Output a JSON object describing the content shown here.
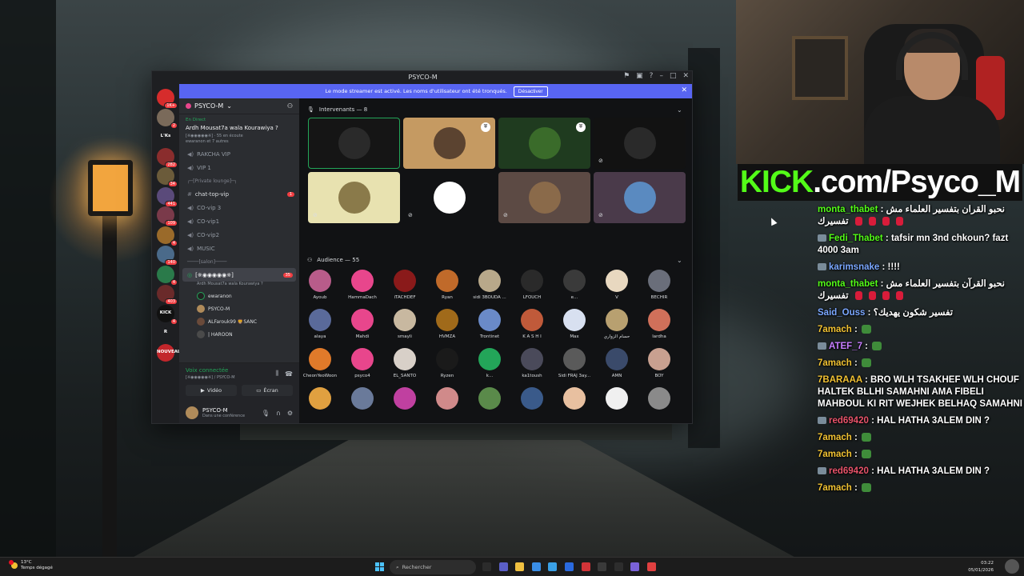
{
  "discord": {
    "window_title": "PSYCO-M",
    "banner": {
      "text": "Le mode streamer est activé. Les noms d'utilisateur ont été tronqués.",
      "button": "Désactiver"
    },
    "guilds": [
      {
        "label": "",
        "badge": "1K+",
        "color": "#d62c2c"
      },
      {
        "label": "",
        "badge": "2",
        "color": "#7a6a5a"
      },
      {
        "label": "L'Ks",
        "badge": "",
        "color": "#1e1f22"
      },
      {
        "label": "",
        "badge": "282",
        "color": "#8a2d2d"
      },
      {
        "label": "",
        "badge": "34",
        "color": "#6b5b3a"
      },
      {
        "label": "",
        "badge": "441",
        "color": "#5a4a7a"
      },
      {
        "label": "",
        "badge": "109",
        "color": "#7a3a4a"
      },
      {
        "label": "",
        "badge": "4",
        "color": "#9a6a2a"
      },
      {
        "label": "",
        "badge": "140",
        "color": "#4a6a8a"
      },
      {
        "label": "",
        "badge": "4",
        "color": "#2a7a4a"
      },
      {
        "label": "",
        "badge": "403",
        "color": "#6a2a2a"
      },
      {
        "label": "KICK",
        "badge": "4",
        "color": "#111"
      },
      {
        "label": "R",
        "badge": "",
        "color": "#1e1f22"
      },
      {
        "label": "NOUVEAU",
        "badge": "",
        "color": "#c2262b"
      }
    ],
    "server_name": "PSYCO-M",
    "live": {
      "label": "En Direct",
      "event_title": "Ardh Mousat7a wala Kourawiya ?",
      "meta": "[※◉◉◉◉◉※] · 55 en écoute",
      "hosts": "ewaranon et 7 autres"
    },
    "channels": [
      {
        "type": "voice",
        "name": "RAKCHA VIP"
      },
      {
        "type": "voice",
        "name": "VIP 1"
      }
    ],
    "category_private": "┌─[Private lounge]─┐",
    "private_channels": [
      {
        "type": "text",
        "name": "chat-top-vip",
        "badge": "1"
      },
      {
        "type": "voice",
        "name": "CO-vip 3"
      },
      {
        "type": "voice",
        "name": "CO-vip1"
      },
      {
        "type": "voice",
        "name": "CO-vip2"
      },
      {
        "type": "voice",
        "name": "MUSIC"
      }
    ],
    "category_salon": "────[salon]────",
    "stage_channel": {
      "name": "[※◉◉◉◉◉※]",
      "badge": "35",
      "sub": "Ardh Mousat7a wala Kourawiya ?"
    },
    "stage_members": [
      "ewaranon",
      "PSYCO-M",
      "ALFarouk99 🦁SANC",
      "| HAROON"
    ],
    "voice_panel": {
      "status": "Voix connectée",
      "location": "[※◉◉◉◉◉※] / PSYCO-M",
      "video": "Vidéo",
      "screen": "Écran"
    },
    "user": {
      "name": "PSYCO-M",
      "status": "Dans une conférence"
    },
    "speakers_header": "Intervenants — 8",
    "audience_header": "Audience — 55",
    "speakers": [
      {
        "color": "#151515",
        "av": "#2a2a2a",
        "shield": false,
        "mic_off": false,
        "active": true
      },
      {
        "color": "#c59a62",
        "av": "#5b4330",
        "shield": true,
        "mic_off": false,
        "active": false
      },
      {
        "color": "#1f3b1f",
        "av": "#3a6b2a",
        "shield": true,
        "mic_off": false,
        "active": false
      },
      {
        "color": "#121212",
        "av": "#2a2a2a",
        "shield": false,
        "mic_off": true,
        "active": false
      },
      {
        "color": "#e8e2b0",
        "av": "#8a7a4a",
        "shield": false,
        "mic_off": true,
        "active": false
      },
      {
        "color": "#111214",
        "av": "#ffffff",
        "shield": false,
        "mic_off": true,
        "active": false
      },
      {
        "color": "#5c4a44",
        "av": "#8a6a4a",
        "shield": false,
        "mic_off": true,
        "active": false
      },
      {
        "color": "#4a3a4a",
        "av": "#5a8ac0",
        "shield": false,
        "mic_off": true,
        "active": false
      }
    ],
    "audience": [
      {
        "name": "Ayoub",
        "color": "#b85c8a"
      },
      {
        "name": "HammaDach",
        "color": "#e8468c"
      },
      {
        "name": "iTACHDEF",
        "color": "#8a1a1a"
      },
      {
        "name": "Ryan",
        "color": "#c06a2a"
      },
      {
        "name": "sidi 3BOUDA ...",
        "color": "#b8a88a"
      },
      {
        "name": "LFOUCH",
        "color": "#2a2a2a"
      },
      {
        "name": "e...",
        "color": "#3a3a3a"
      },
      {
        "name": "V",
        "color": "#e8d8c0"
      },
      {
        "name": "BECHIR",
        "color": "#6a6e7a"
      },
      {
        "name": "alaya",
        "color": "#5a6a9a"
      },
      {
        "name": "Mahdi",
        "color": "#e8468c"
      },
      {
        "name": "smayli",
        "color": "#c8b8a0"
      },
      {
        "name": "HVMZA",
        "color": "#a06a1a"
      },
      {
        "name": "Trontinet",
        "color": "#6a8ac8"
      },
      {
        "name": "K A S H I",
        "color": "#c05a3a"
      },
      {
        "name": "Max",
        "color": "#d8e0f0"
      },
      {
        "name": "حسام الزواري",
        "color": "#b8a070"
      },
      {
        "name": "lardha",
        "color": "#d0705a"
      },
      {
        "name": "CheonYeoWoon",
        "color": "#e07a2a"
      },
      {
        "name": "psyco4",
        "color": "#e8468c"
      },
      {
        "name": "EL_SANTO",
        "color": "#d8d0c8"
      },
      {
        "name": "Ryzen",
        "color": "#1a1a1a"
      },
      {
        "name": "k...",
        "color": "#23a559"
      },
      {
        "name": "ka1toush",
        "color": "#4a4a5a"
      },
      {
        "name": "Sidi FRAJ 3ay...",
        "color": "#5a5a5a"
      },
      {
        "name": "AMN",
        "color": "#3a4a6a"
      },
      {
        "name": "BOY",
        "color": "#c8a090"
      },
      {
        "name": "",
        "color": "#e0a040"
      },
      {
        "name": "",
        "color": "#6a7a9a"
      },
      {
        "name": "",
        "color": "#c040a0"
      },
      {
        "name": "",
        "color": "#d08a8a"
      },
      {
        "name": "",
        "color": "#5a8a4a"
      },
      {
        "name": "",
        "color": "#3a5a8a"
      },
      {
        "name": "",
        "color": "#e8c0a0"
      },
      {
        "name": "",
        "color": "#f0f0f0"
      },
      {
        "name": "",
        "color": "#8a8a8a"
      }
    ]
  },
  "kick": {
    "part1": "KICK",
    "part2": ".com/Psyco_M"
  },
  "chat": [
    {
      "user": "monta_thabet",
      "color": "#53fc18",
      "text": "نحبو القران بتفسير العلماء مش تفسيرك",
      "badge": false,
      "reds": 4
    },
    {
      "user": "Fedi_Thabet",
      "color": "#53fc18",
      "text": "tafsir mn 3nd chkoun? fazt 4000 3am",
      "badge": true,
      "reds": 0
    },
    {
      "user": "karimsnake",
      "color": "#7aa7ff",
      "text": "!!!!",
      "badge": true,
      "reds": 0
    },
    {
      "user": "monta_thabet",
      "color": "#53fc18",
      "text": "نحبو القرآن بتفسير العلماء مش تفسيرك",
      "badge": false,
      "reds": 4
    },
    {
      "user": "Said_Ouss",
      "color": "#7aa7ff",
      "text": "تفسير شكون يهديك؟",
      "badge": false,
      "reds": 0
    },
    {
      "user": "7amach",
      "color": "#f1c232",
      "text": "",
      "badge": false,
      "emote": true,
      "reds": 0
    },
    {
      "user": "ATEF_7",
      "color": "#c77dff",
      "text": "",
      "badge": true,
      "emote": true,
      "reds": 0
    },
    {
      "user": "7amach",
      "color": "#f1c232",
      "text": "",
      "badge": false,
      "emote": true,
      "reds": 0
    },
    {
      "user": "7BARAAA",
      "color": "#f1c232",
      "text": "BRO WLH TSAKHEF WLH CHOUF HALTEK BLLHI SAMAHNI AMA FIBELI MAHBOUL KI RIT WEJHEK BELHAQ SAMAHNI",
      "badge": false,
      "reds": 0
    },
    {
      "user": "red69420",
      "color": "#e8536a",
      "text": "HAL HATHA 3ALEM DIN ?",
      "badge": true,
      "reds": 0
    },
    {
      "user": "7amach",
      "color": "#f1c232",
      "text": "",
      "badge": false,
      "emote": true,
      "reds": 0
    },
    {
      "user": "7amach",
      "color": "#f1c232",
      "text": "",
      "badge": false,
      "emote": true,
      "reds": 0
    },
    {
      "user": "red69420",
      "color": "#e8536a",
      "text": "HAL HATHA 3ALEM DIN ?",
      "badge": true,
      "reds": 0
    },
    {
      "user": "7amach",
      "color": "#f1c232",
      "text": "",
      "badge": false,
      "emote": true,
      "reds": 0
    }
  ],
  "taskbar": {
    "temp": "13°C",
    "weather": "Temps dégagé",
    "search": "Rechercher",
    "time": "03:22",
    "date": "05/01/2026",
    "icon_colors": [
      "#2b2b2b",
      "#5b5fc7",
      "#f0c040",
      "#3a8ee6",
      "#3aa0e6",
      "#2a6adf",
      "#d13438",
      "#3a3a3a",
      "#2d2d2d",
      "#7a62d8",
      "#e04040"
    ]
  }
}
